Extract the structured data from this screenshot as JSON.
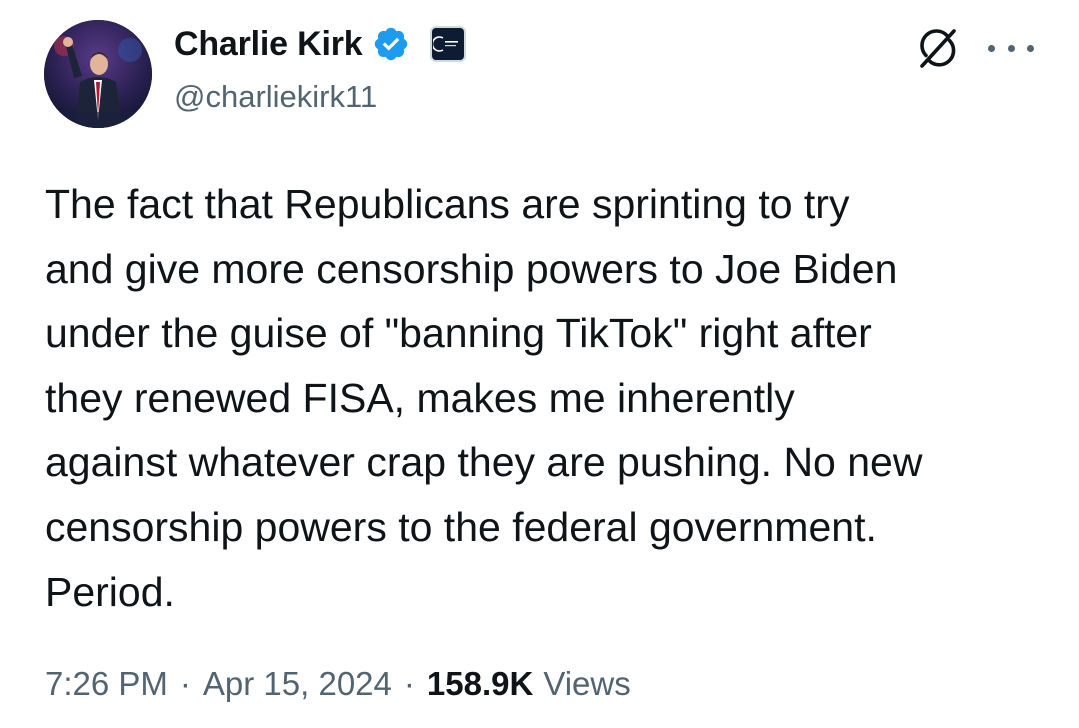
{
  "author": {
    "display_name": "Charlie Kirk",
    "handle": "@charliekirk11",
    "verified": true,
    "affiliate_badge_icon": "organization-badge-icon"
  },
  "tweet": {
    "lines": [
      "The fact that Republicans are sprinting to try",
      "and give more censorship powers to Joe Biden",
      "under the guise of \"banning TikTok\" right after",
      "they renewed FISA, makes me inherently",
      "against whatever crap they are pushing. No new",
      "censorship powers to the federal government.",
      "Period."
    ]
  },
  "meta": {
    "time": "7:26 PM",
    "separator": "·",
    "date": "Apr 15, 2024",
    "views_count": "158.9K",
    "views_label": "Views"
  },
  "colors": {
    "text_primary": "#0f1419",
    "text_secondary": "#536471",
    "verified_blue": "#1d9bf0"
  }
}
